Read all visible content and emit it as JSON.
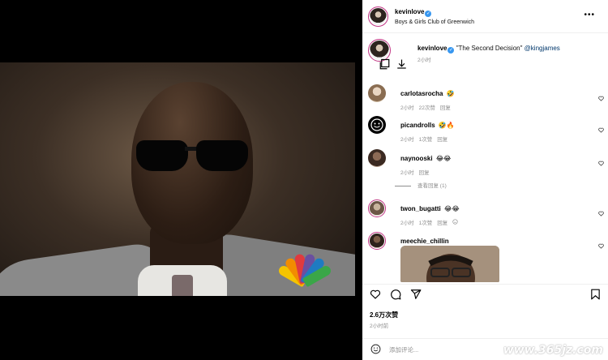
{
  "post": {
    "username": "kevinlove",
    "location": "Boys & Girls Club of Greenwich",
    "caption_text": "\"The Second Decision\"",
    "caption_mention": "@kingjames",
    "caption_time": "2小时",
    "likes": "2.6万次赞",
    "time": "2小时前"
  },
  "comments": [
    {
      "username": "carlotasrocha",
      "emoji": "🤣",
      "time": "2小时",
      "likes": "22次赞",
      "reply": "回复"
    },
    {
      "username": "picandrolls",
      "emoji": "🤣🔥",
      "time": "2小时",
      "likes": "1次赞",
      "reply": "回复"
    },
    {
      "username": "naynooski",
      "emoji": "😂😂",
      "time": "2小时",
      "likes": "",
      "reply": "回复"
    },
    {
      "username": "twon_bugatti",
      "emoji": "😂😂",
      "time": "2小时",
      "likes": "1次赞",
      "reply": "回复"
    },
    {
      "username": "meechie_chillin",
      "emoji": "",
      "time": "",
      "likes": "",
      "reply": ""
    }
  ],
  "view_replies": "查看回复 (1)",
  "comment_box": {
    "placeholder": "添加评论..."
  },
  "watermark": "www.365jz.com",
  "more_label": "•••",
  "icons": {
    "more": "more-dots-icon",
    "verified": "verified-badge-icon",
    "copy": "copy-icon",
    "download": "download-icon",
    "like": "heart-icon",
    "comment": "comment-icon",
    "share": "share-icon",
    "save": "bookmark-icon",
    "emoji": "emoji-icon",
    "sound": "speaker-icon"
  },
  "colors": {
    "verified": "#3897f0",
    "mention": "#00376b",
    "meta": "#8e8e8e",
    "story_ring": "#c13584"
  }
}
